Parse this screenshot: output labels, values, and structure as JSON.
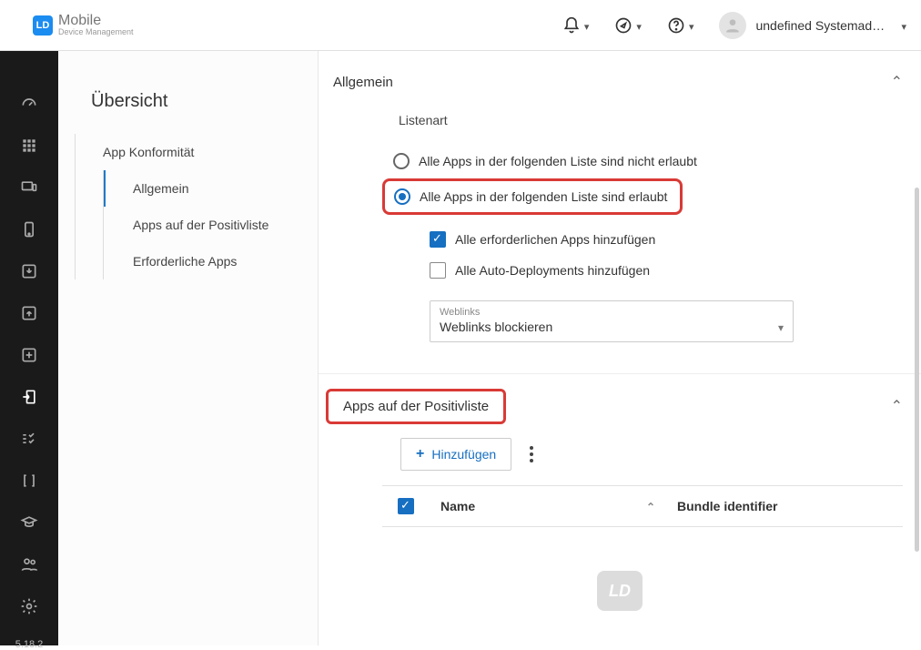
{
  "brand": {
    "badge": "LD",
    "line1": "Mobile",
    "line2": "Device Management"
  },
  "header": {
    "username": "undefined Systemadmi..."
  },
  "rail": {
    "version": "5.18.2"
  },
  "sidebar": {
    "title": "Übersicht",
    "root": "App Konformität",
    "items": [
      "Allgemein",
      "Apps auf der Positivliste",
      "Erforderliche Apps"
    ]
  },
  "section_general": {
    "title": "Allgemein",
    "list_type_label": "Listenart",
    "radio_not_allowed": "Alle Apps in der folgenden Liste sind nicht erlaubt",
    "radio_allowed": "Alle Apps in der folgenden Liste sind erlaubt",
    "chk_required": "Alle erforderlichen Apps hinzufügen",
    "chk_autodeploy": "Alle Auto-Deployments hinzufügen",
    "select_label": "Weblinks",
    "select_value": "Weblinks blockieren"
  },
  "section_allowlist": {
    "title": "Apps auf der Positivliste",
    "add_button": "Hinzufügen",
    "columns": {
      "name": "Name",
      "bundle": "Bundle identifier"
    },
    "placeholder_badge": "LD"
  }
}
